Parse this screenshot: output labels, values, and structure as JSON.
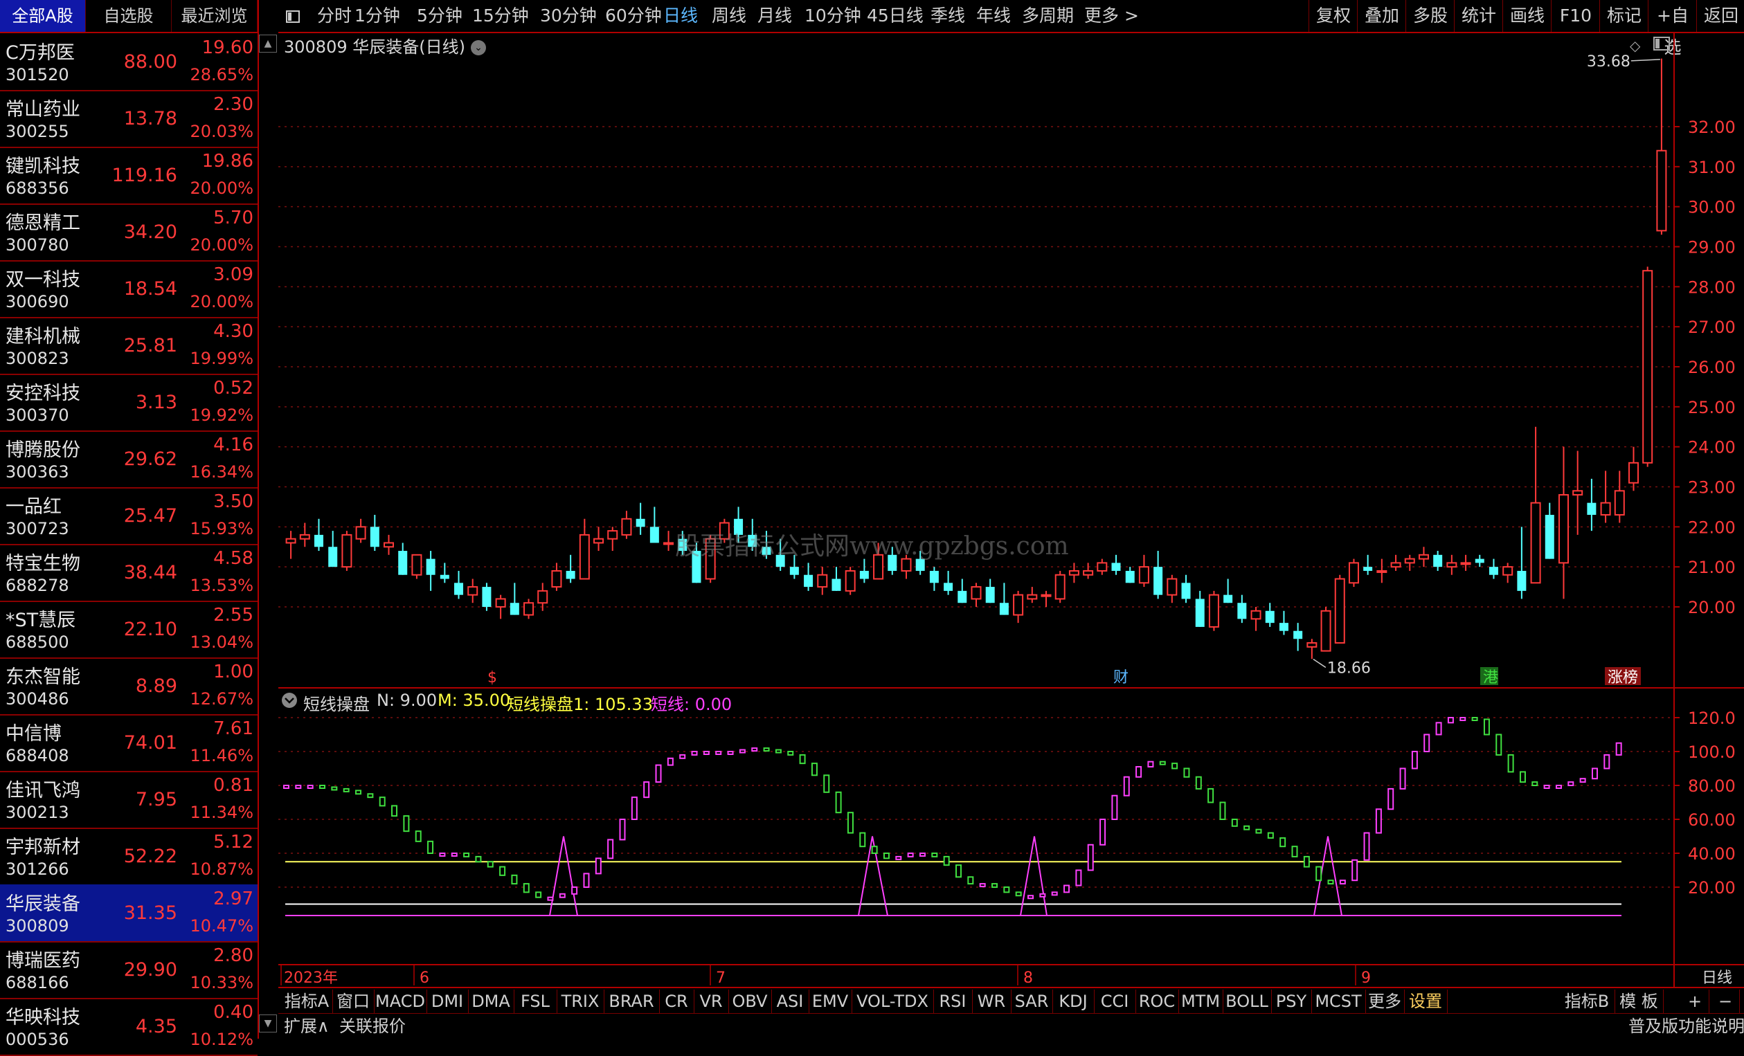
{
  "left_panel": {
    "tabs": [
      {
        "label": "全部A股",
        "active": true
      },
      {
        "label": "自选股",
        "active": false
      },
      {
        "label": "最近浏览",
        "active": false
      }
    ],
    "stocks": [
      {
        "name": "C万邦医",
        "code": "301520",
        "price": "88.00",
        "change": "19.60",
        "pct": "28.65%"
      },
      {
        "name": "常山药业",
        "code": "300255",
        "price": "13.78",
        "change": "2.30",
        "pct": "20.03%"
      },
      {
        "name": "键凯科技",
        "code": "688356",
        "price": "119.16",
        "change": "19.86",
        "pct": "20.00%"
      },
      {
        "name": "德恩精工",
        "code": "300780",
        "price": "34.20",
        "change": "5.70",
        "pct": "20.00%"
      },
      {
        "name": "双一科技",
        "code": "300690",
        "price": "18.54",
        "change": "3.09",
        "pct": "20.00%"
      },
      {
        "name": "建科机械",
        "code": "300823",
        "price": "25.81",
        "change": "4.30",
        "pct": "19.99%"
      },
      {
        "name": "安控科技",
        "code": "300370",
        "price": "3.13",
        "change": "0.52",
        "pct": "19.92%"
      },
      {
        "name": "博腾股份",
        "code": "300363",
        "price": "29.62",
        "change": "4.16",
        "pct": "16.34%"
      },
      {
        "name": "一品红",
        "code": "300723",
        "price": "25.47",
        "change": "3.50",
        "pct": "15.93%"
      },
      {
        "name": "特宝生物",
        "code": "688278",
        "price": "38.44",
        "change": "4.58",
        "pct": "13.53%"
      },
      {
        "name": "*ST慧辰",
        "code": "688500",
        "price": "22.10",
        "change": "2.55",
        "pct": "13.04%"
      },
      {
        "name": "东杰智能",
        "code": "300486",
        "price": "8.89",
        "change": "1.00",
        "pct": "12.67%"
      },
      {
        "name": "中信博",
        "code": "688408",
        "price": "74.01",
        "change": "7.61",
        "pct": "11.46%"
      },
      {
        "name": "佳讯飞鸿",
        "code": "300213",
        "price": "7.95",
        "change": "0.81",
        "pct": "11.34%"
      },
      {
        "name": "宇邦新材",
        "code": "301266",
        "price": "52.22",
        "change": "5.12",
        "pct": "10.87%"
      },
      {
        "name": "华辰装备",
        "code": "300809",
        "price": "31.35",
        "change": "2.97",
        "pct": "10.47%",
        "selected": true
      },
      {
        "name": "博瑞医药",
        "code": "688166",
        "price": "29.90",
        "change": "2.80",
        "pct": "10.33%"
      },
      {
        "name": "华映科技",
        "code": "000536",
        "price": "4.35",
        "change": "0.40",
        "pct": "10.12%"
      }
    ]
  },
  "toolbar": {
    "periods": [
      "分时",
      "1分钟",
      "5分钟",
      "15分钟",
      "30分钟",
      "60分钟",
      "日线",
      "周线",
      "月线",
      "10分钟",
      "45日线",
      "季线",
      "年线",
      "多周期",
      "更多 >"
    ],
    "active_period": "日线",
    "right_buttons": [
      "复权",
      "叠加",
      "多股",
      "统计",
      "画线",
      "F10",
      "标记",
      "+自选",
      "返回"
    ]
  },
  "chart": {
    "title": "300809 华辰装备(日线)",
    "high_label": "33.68",
    "low_label": "18.66",
    "watermark": "股票指标公式网www.gpzbgs.com",
    "event_markers": [
      {
        "text": "$",
        "color": "#ff3a3a"
      },
      {
        "text": "财",
        "color": "#5cb8ff"
      },
      {
        "text": "港",
        "color": "#40e040"
      },
      {
        "text": "涨榜",
        "color": "#ffffff"
      }
    ],
    "price_ticks": [
      "32.00",
      "31.00",
      "30.00",
      "29.00",
      "28.00",
      "27.00",
      "26.00",
      "25.00",
      "24.00",
      "23.00",
      "22.00",
      "21.00",
      "20.00"
    ],
    "indicator_ticks": [
      "120.0",
      "100.0",
      "80.00",
      "60.00",
      "40.00",
      "20.00"
    ],
    "date_labels": [
      "2023年",
      "6",
      "7",
      "8",
      "9"
    ],
    "period_label": "日线"
  },
  "indicator": {
    "name": "短线操盘",
    "n_label": "N: 9.00",
    "m_label": "M: 35.00",
    "line1_label": "短线操盘1: 105.33",
    "line2_label": "短线: 0.00"
  },
  "chart_data": {
    "type": "candlestick",
    "title": "300809 华辰装备(日线)",
    "y_range": [
      18.0,
      34.0
    ],
    "candles": [
      [
        21.6,
        21.9,
        21.2,
        21.7
      ],
      [
        21.7,
        22.1,
        21.5,
        21.8
      ],
      [
        21.8,
        22.2,
        21.4,
        21.5
      ],
      [
        21.5,
        21.9,
        21.0,
        21.0
      ],
      [
        21.0,
        21.9,
        20.9,
        21.8
      ],
      [
        21.7,
        22.2,
        21.6,
        22.0
      ],
      [
        22.0,
        22.3,
        21.4,
        21.5
      ],
      [
        21.5,
        21.8,
        21.3,
        21.6
      ],
      [
        21.4,
        21.6,
        20.8,
        20.8
      ],
      [
        20.8,
        21.3,
        20.7,
        21.3
      ],
      [
        21.2,
        21.4,
        20.4,
        20.8
      ],
      [
        20.8,
        21.1,
        20.6,
        20.7
      ],
      [
        20.6,
        20.9,
        20.2,
        20.3
      ],
      [
        20.3,
        20.7,
        20.1,
        20.5
      ],
      [
        20.5,
        20.6,
        19.9,
        20.0
      ],
      [
        20.0,
        20.3,
        19.7,
        20.2
      ],
      [
        20.1,
        20.6,
        19.8,
        19.8
      ],
      [
        19.8,
        20.2,
        19.7,
        20.1
      ],
      [
        20.1,
        20.6,
        19.9,
        20.4
      ],
      [
        20.5,
        21.1,
        20.4,
        20.9
      ],
      [
        20.9,
        21.3,
        20.6,
        20.7
      ],
      [
        20.7,
        22.2,
        20.7,
        21.8
      ],
      [
        21.6,
        22.0,
        21.4,
        21.7
      ],
      [
        21.7,
        22.0,
        21.4,
        21.9
      ],
      [
        21.8,
        22.4,
        21.7,
        22.2
      ],
      [
        22.2,
        22.6,
        21.8,
        22.0
      ],
      [
        22.0,
        22.5,
        21.8,
        21.6
      ],
      [
        21.6,
        21.9,
        21.4,
        21.6
      ],
      [
        21.7,
        21.9,
        21.3,
        21.4
      ],
      [
        21.4,
        21.6,
        20.6,
        20.6
      ],
      [
        20.7,
        21.8,
        20.6,
        21.7
      ],
      [
        21.7,
        22.2,
        21.6,
        22.1
      ],
      [
        22.2,
        22.5,
        21.6,
        21.8
      ],
      [
        21.8,
        22.2,
        21.4,
        21.5
      ],
      [
        21.5,
        21.9,
        21.2,
        21.3
      ],
      [
        21.3,
        21.7,
        20.9,
        21.0
      ],
      [
        21.0,
        21.3,
        20.7,
        20.8
      ],
      [
        20.8,
        21.1,
        20.4,
        20.5
      ],
      [
        20.5,
        21.0,
        20.3,
        20.8
      ],
      [
        20.7,
        21.0,
        20.4,
        20.4
      ],
      [
        20.4,
        21.0,
        20.3,
        20.9
      ],
      [
        20.9,
        21.2,
        20.6,
        20.7
      ],
      [
        20.7,
        21.6,
        20.7,
        21.3
      ],
      [
        21.3,
        21.5,
        20.8,
        20.9
      ],
      [
        20.9,
        21.3,
        20.7,
        21.2
      ],
      [
        21.2,
        21.4,
        20.8,
        20.9
      ],
      [
        20.9,
        21.0,
        20.4,
        20.6
      ],
      [
        20.6,
        20.9,
        20.3,
        20.4
      ],
      [
        20.4,
        20.7,
        20.1,
        20.1
      ],
      [
        20.2,
        20.6,
        20.0,
        20.5
      ],
      [
        20.5,
        20.7,
        20.1,
        20.1
      ],
      [
        20.1,
        20.6,
        19.8,
        19.8
      ],
      [
        19.8,
        20.4,
        19.6,
        20.3
      ],
      [
        20.2,
        20.5,
        20.1,
        20.3
      ],
      [
        20.3,
        20.4,
        20.0,
        20.3
      ],
      [
        20.2,
        20.9,
        20.1,
        20.8
      ],
      [
        20.8,
        21.1,
        20.6,
        20.9
      ],
      [
        20.8,
        21.1,
        20.7,
        20.9
      ],
      [
        20.9,
        21.2,
        20.8,
        21.1
      ],
      [
        21.1,
        21.3,
        20.8,
        20.9
      ],
      [
        20.9,
        21.0,
        20.6,
        20.6
      ],
      [
        20.6,
        21.3,
        20.5,
        21.0
      ],
      [
        21.0,
        21.4,
        20.2,
        20.3
      ],
      [
        20.3,
        20.8,
        20.1,
        20.7
      ],
      [
        20.6,
        20.8,
        20.1,
        20.2
      ],
      [
        20.2,
        20.4,
        19.5,
        19.5
      ],
      [
        19.5,
        20.4,
        19.4,
        20.3
      ],
      [
        20.3,
        20.7,
        20.1,
        20.1
      ],
      [
        20.1,
        20.3,
        19.6,
        19.7
      ],
      [
        19.7,
        20.0,
        19.4,
        19.9
      ],
      [
        19.9,
        20.1,
        19.5,
        19.6
      ],
      [
        19.6,
        19.9,
        19.3,
        19.4
      ],
      [
        19.4,
        19.6,
        18.9,
        19.2
      ],
      [
        19.0,
        19.2,
        18.7,
        19.1
      ],
      [
        18.9,
        20.0,
        18.9,
        19.9
      ],
      [
        19.1,
        20.8,
        19.1,
        20.7
      ],
      [
        20.6,
        21.2,
        20.5,
        21.1
      ],
      [
        21.0,
        21.3,
        20.8,
        20.9
      ],
      [
        20.9,
        21.2,
        20.6,
        20.9
      ],
      [
        21.0,
        21.3,
        20.9,
        21.1
      ],
      [
        21.1,
        21.3,
        20.9,
        21.2
      ],
      [
        21.2,
        21.5,
        21.0,
        21.3
      ],
      [
        21.3,
        21.4,
        20.9,
        21.0
      ],
      [
        21.0,
        21.3,
        20.8,
        21.1
      ],
      [
        21.1,
        21.3,
        20.9,
        21.1
      ],
      [
        21.2,
        21.3,
        21.0,
        21.1
      ],
      [
        21.0,
        21.2,
        20.7,
        20.8
      ],
      [
        20.8,
        21.1,
        20.6,
        21.0
      ],
      [
        20.9,
        22.0,
        20.2,
        20.4
      ],
      [
        20.6,
        24.5,
        21.0,
        22.6
      ],
      [
        22.3,
        22.6,
        21.2,
        21.2
      ],
      [
        21.1,
        24.0,
        20.2,
        22.8
      ],
      [
        22.8,
        23.9,
        21.8,
        22.9
      ],
      [
        22.6,
        23.2,
        21.9,
        22.3
      ],
      [
        22.3,
        23.4,
        22.1,
        22.6
      ],
      [
        22.3,
        23.4,
        22.1,
        22.9
      ],
      [
        23.1,
        24.0,
        22.9,
        23.6
      ],
      [
        23.6,
        28.5,
        23.5,
        28.4
      ],
      [
        29.4,
        33.7,
        29.3,
        31.4
      ]
    ],
    "indicator_series": {
      "name": "短线操盘",
      "ylim": [
        0,
        130
      ],
      "n": 9.0,
      "m": 35.0,
      "thresholds": [
        35,
        10
      ],
      "values": [
        80,
        80,
        80,
        79,
        78,
        77,
        75,
        73,
        68,
        62,
        53,
        47,
        40,
        40,
        40,
        38,
        35,
        32,
        27,
        22,
        17,
        14,
        14,
        16,
        20,
        28,
        37,
        48,
        60,
        73,
        82,
        92,
        96,
        98,
        100,
        100,
        100,
        100,
        101,
        102,
        101,
        100,
        98,
        93,
        86,
        76,
        64,
        52,
        44,
        40,
        37,
        38,
        40,
        40,
        38,
        33,
        26,
        22,
        22,
        20,
        17,
        15,
        15,
        16,
        17,
        21,
        30,
        45,
        60,
        74,
        85,
        91,
        94,
        93,
        90,
        85,
        78,
        70,
        60,
        56,
        54,
        52,
        49,
        44,
        38,
        32,
        24,
        22,
        24,
        36,
        52,
        66,
        78,
        90,
        100,
        110,
        117,
        120,
        120,
        119,
        110,
        98,
        88,
        82,
        80,
        80,
        80,
        82,
        84,
        90,
        98,
        105
      ]
    }
  },
  "bottom_tabs": [
    "指标A",
    "窗口",
    "MACD",
    "DMI",
    "DMA",
    "FSL",
    "TRIX",
    "BRAR",
    "CR",
    "VR",
    "OBV",
    "ASI",
    "EMV",
    "VOL-TDX",
    "RSI",
    "WR",
    "SAR",
    "KDJ",
    "CCI",
    "ROC",
    "MTM",
    "BOLL",
    "PSY",
    "MCST",
    "更多",
    "设置"
  ],
  "bottom_right_tabs": [
    "指标B",
    "模 板",
    "+",
    "−"
  ],
  "bottom_bar": {
    "expand": "扩展∧",
    "related": "关联报价",
    "right_text": "普及版功能说明"
  }
}
